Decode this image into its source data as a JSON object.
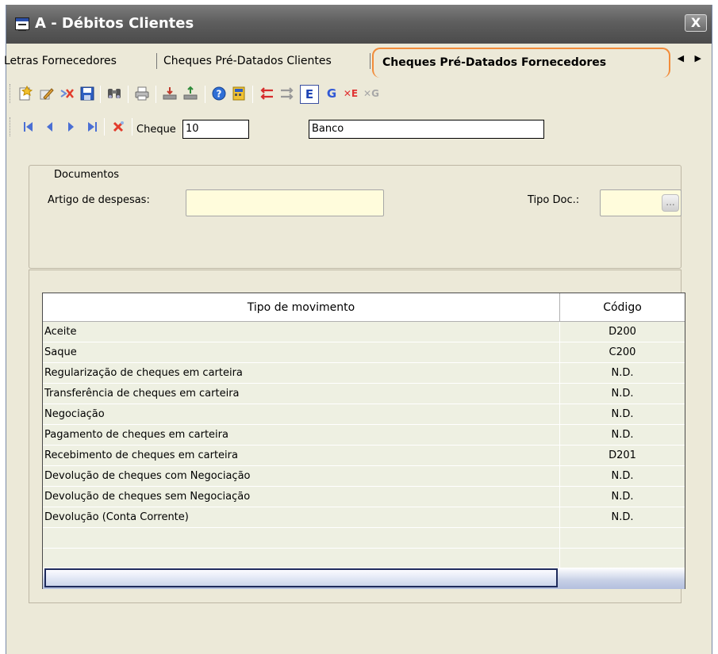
{
  "window": {
    "title": "A - Débitos Clientes",
    "close_label": "X"
  },
  "tabs": {
    "items": [
      {
        "label": "Letras Fornecedores"
      },
      {
        "label": "Cheques Pré-Datados Clientes"
      }
    ],
    "active": "Cheques Pré-Datados Fornecedores",
    "scroll_arrows": "◀ ▶"
  },
  "toolbar": {
    "e_label": "E",
    "g_label": "G",
    "xe_label": "✕E",
    "xg_label": "✕G"
  },
  "navbar": {
    "cheque_label": "Cheque",
    "cheque_value": "10",
    "banco_value": "Banco"
  },
  "documentos": {
    "title": "Documentos",
    "artigo_label": "Artigo de despesas:",
    "artigo_value": "",
    "tipo_doc_label": "Tipo Doc.:",
    "tipo_doc_value": "",
    "ellipsis": "..."
  },
  "grid": {
    "headers": {
      "tipo": "Tipo de movimento",
      "codigo": "Código"
    },
    "rows": [
      {
        "tipo": "Aceite",
        "codigo": "D200"
      },
      {
        "tipo": "Saque",
        "codigo": "C200"
      },
      {
        "tipo": "Regularização de cheques em carteira",
        "codigo": "N.D."
      },
      {
        "tipo": "Transferência de cheques em carteira",
        "codigo": "N.D."
      },
      {
        "tipo": "Negociação",
        "codigo": "N.D."
      },
      {
        "tipo": "Pagamento de cheques em carteira",
        "codigo": "N.D."
      },
      {
        "tipo": "Recebimento de cheques em carteira",
        "codigo": "D201"
      },
      {
        "tipo": "Devolução de cheques com Negociação",
        "codigo": "N.D."
      },
      {
        "tipo": "Devolução de cheques sem Negociação",
        "codigo": "N.D."
      },
      {
        "tipo": "Devolução (Conta Corrente)",
        "codigo": "N.D."
      },
      {
        "tipo": "",
        "codigo": ""
      }
    ]
  }
}
